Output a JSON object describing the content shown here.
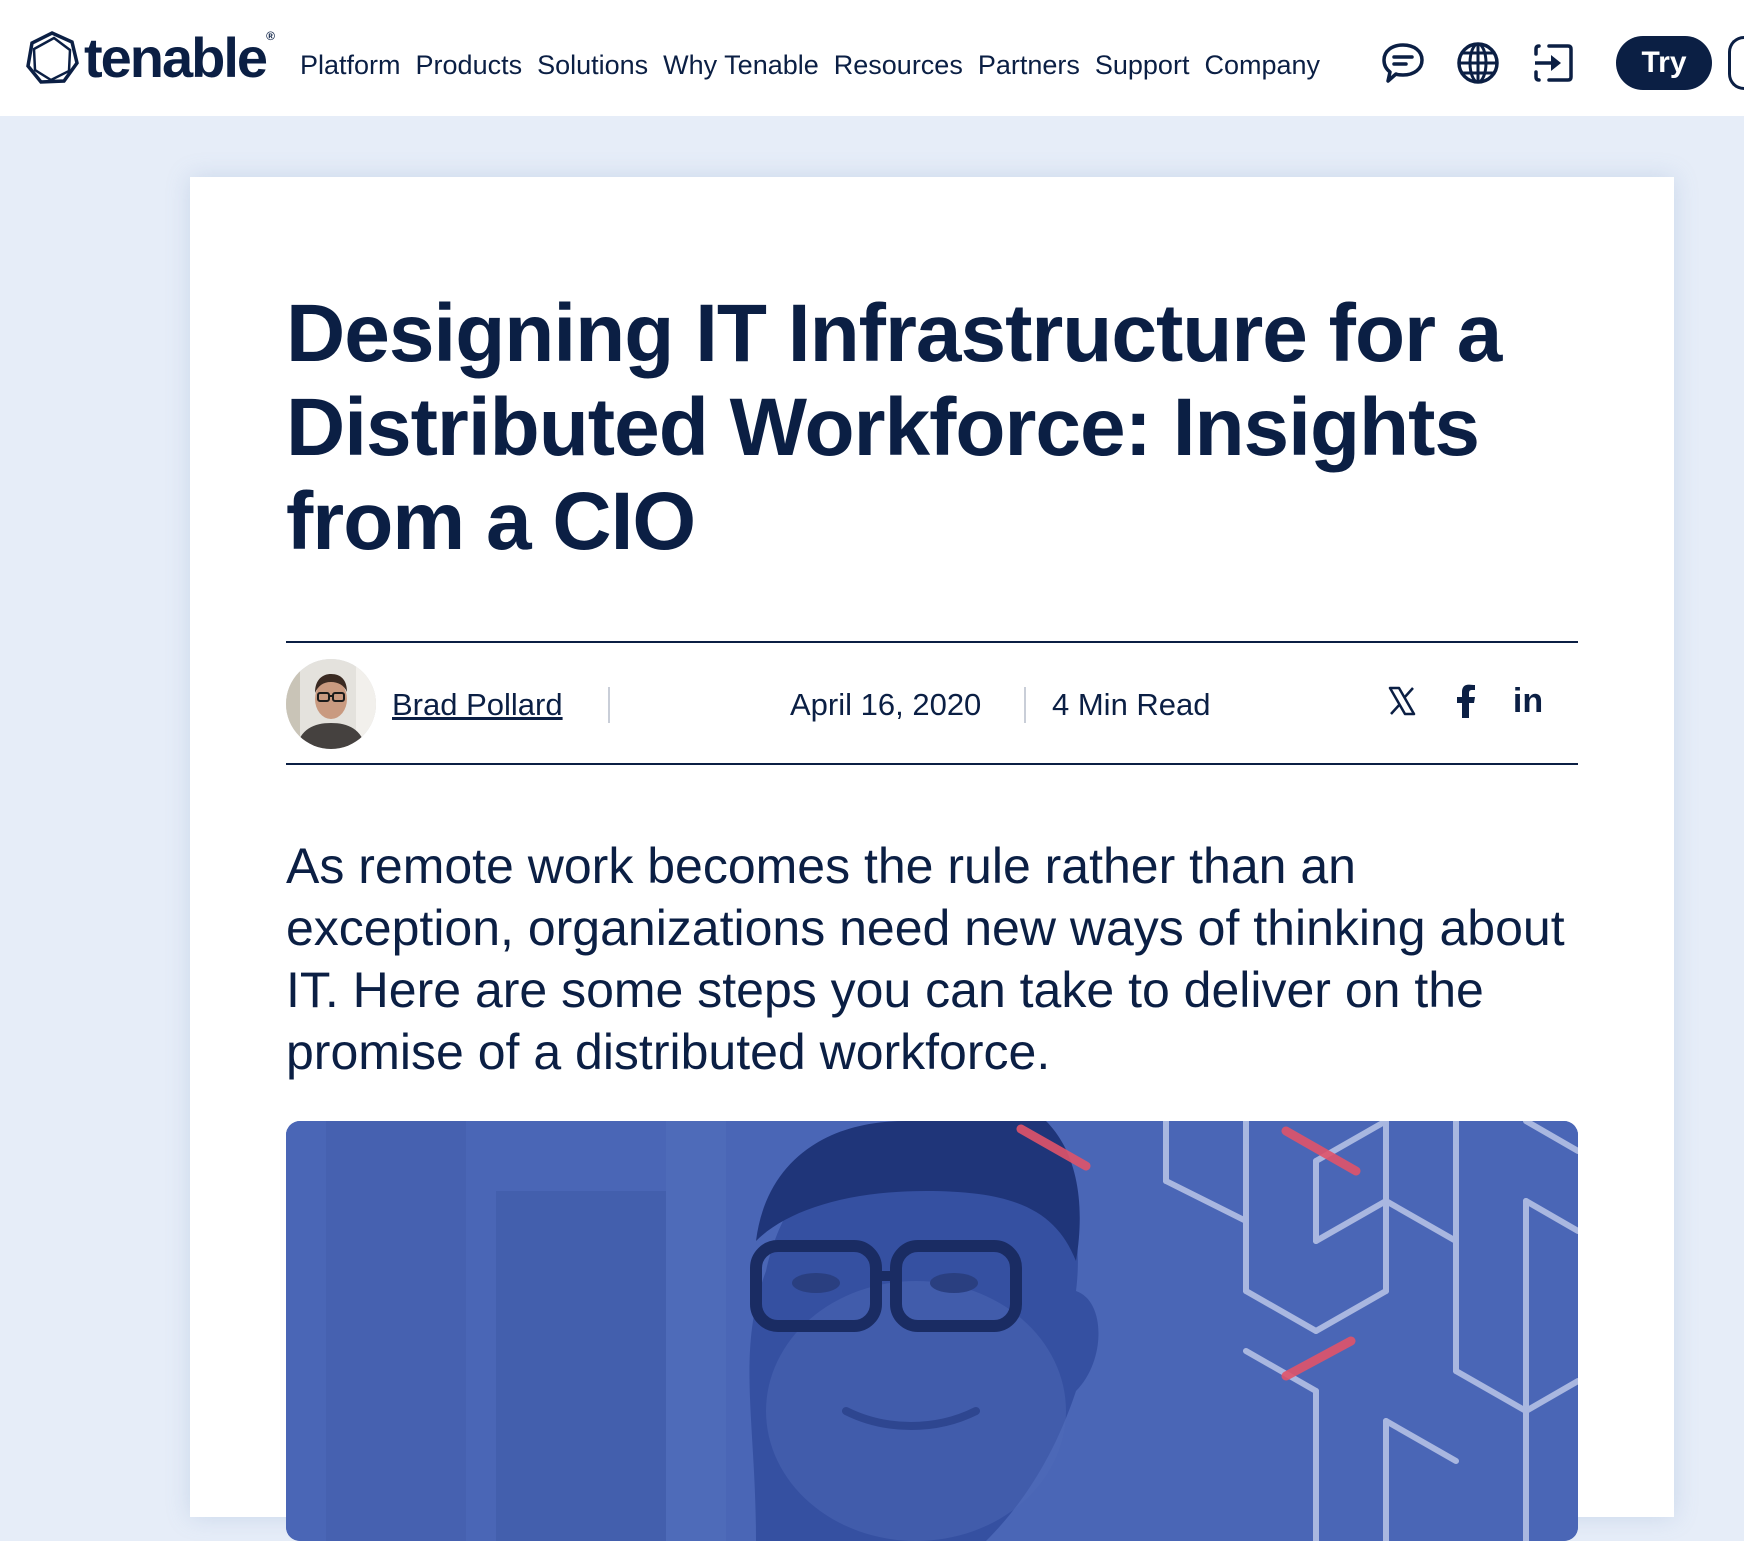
{
  "nav": {
    "logo_text": "tenable",
    "logo_reg": "®",
    "links": [
      "Platform",
      "Products",
      "Solutions",
      "Why Tenable",
      "Resources",
      "Partners",
      "Support",
      "Company"
    ],
    "try_label": "Try",
    "icons": [
      "chat-icon",
      "globe-icon",
      "login-icon"
    ]
  },
  "article": {
    "title": "Designing IT Infrastructure for a Distributed Workforce: Insights from a CIO",
    "author": "Brad Pollard",
    "date": "April 16, 2020",
    "read_time": "4 Min Read",
    "share_icons": [
      "x-icon",
      "facebook-icon",
      "linkedin-icon"
    ],
    "linkedin_glyph": "in",
    "lead": "As remote work becomes the rule rather than an exception, organizations need new ways of thinking about IT. Here are some steps you can take to deliver on the promise of a distributed workforce."
  },
  "colors": {
    "navy": "#0b1f44",
    "page_bg": "#e6edf8",
    "hero_blue": "#4a66b6",
    "accent_red": "#e0546a"
  }
}
